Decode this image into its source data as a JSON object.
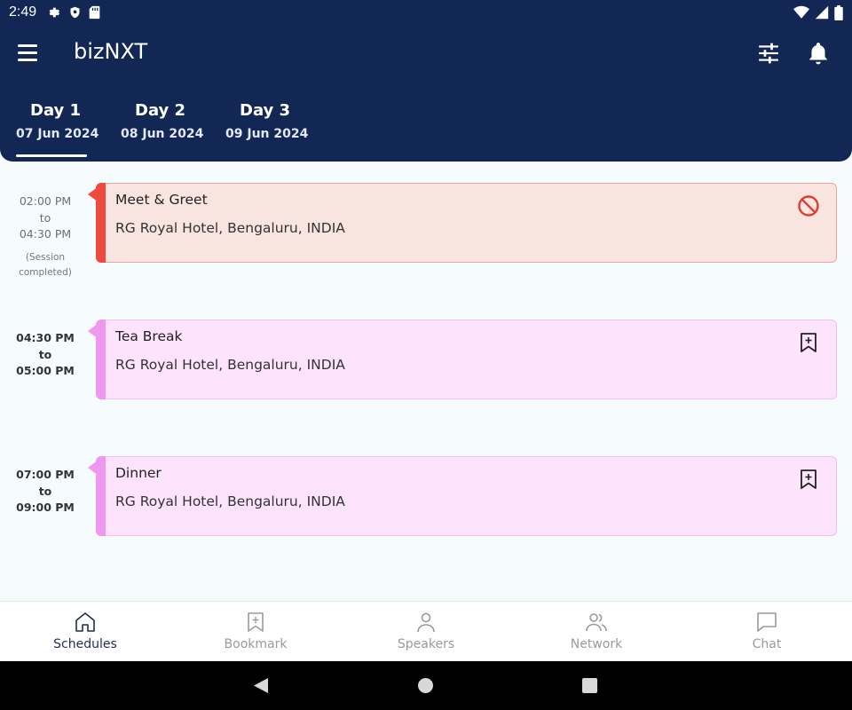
{
  "status_bar": {
    "time": "2:49"
  },
  "app": {
    "title": "bizNXT"
  },
  "tabs": [
    {
      "name": "Day 1",
      "date": "07 Jun 2024"
    },
    {
      "name": "Day 2",
      "date": "08 Jun 2024"
    },
    {
      "name": "Day 3",
      "date": "09 Jun 2024"
    }
  ],
  "schedule": [
    {
      "start": "02:00 PM",
      "sep": "to",
      "end": "04:30 PM",
      "note": "(Session completed)",
      "title": "Meet & Greet",
      "venue": "RG Royal Hotel, Bengaluru, INDIA",
      "action_icon": "blocked-icon"
    },
    {
      "start": "04:30 PM",
      "sep": "to",
      "end": "05:00 PM",
      "title": "Tea Break",
      "venue": "RG Royal Hotel, Bengaluru, INDIA",
      "action_icon": "bookmark-add-icon"
    },
    {
      "start": "07:00 PM",
      "sep": "to",
      "end": "09:00 PM",
      "title": "Dinner",
      "venue": "RG Royal Hotel, Bengaluru, INDIA",
      "action_icon": "bookmark-add-icon"
    }
  ],
  "bottom_nav": [
    {
      "label": "Schedules",
      "icon": "home-icon"
    },
    {
      "label": "Bookmark",
      "icon": "bookmark-icon"
    },
    {
      "label": "Speakers",
      "icon": "person-icon"
    },
    {
      "label": "Network",
      "icon": "people-icon"
    },
    {
      "label": "Chat",
      "icon": "chat-icon"
    }
  ],
  "colors": {
    "header": "#132754",
    "completed_card_bg": "#f9e5e0",
    "completed_card_border": "#f0a39a",
    "completed_stripe": "#ee4b3e",
    "upcoming_card_bg": "#fde3fb",
    "upcoming_card_border": "#f4bdf0",
    "upcoming_stripe": "#ef98ef",
    "blocked_icon": "#e03b30"
  }
}
